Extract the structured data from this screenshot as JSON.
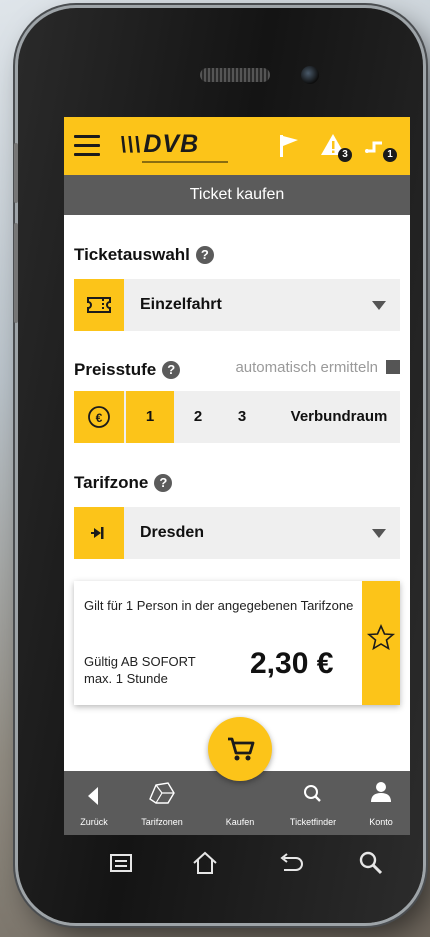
{
  "header": {
    "logo_text": "DVB",
    "logo_stripes": "\\\\\\",
    "notifications": {
      "alerts_count": "3",
      "routes_count": "1"
    }
  },
  "subheader": {
    "title": "Ticket kaufen"
  },
  "ticket_selection": {
    "label": "Ticketauswahl",
    "help": "?",
    "value": "Einzelfahrt"
  },
  "price_level": {
    "label": "Preisstufe",
    "help": "?",
    "auto_label": "automatisch ermitteln",
    "currency_symbol": "€",
    "levels": [
      "1",
      "2",
      "3",
      "Verbundraum"
    ],
    "selected": "1"
  },
  "tariff_zone": {
    "label": "Tarifzone",
    "help": "?",
    "value": "Dresden"
  },
  "ticket_card": {
    "description": "Gilt für 1 Person in der angegebenen Tarifzone",
    "validity_line1": "Gültig AB SOFORT",
    "validity_line2": "max. 1 Stunde",
    "price": "2,30 €"
  },
  "bottom_nav": {
    "back": "Zurück",
    "zones": "Tarifzonen",
    "buy": "Kaufen",
    "finder": "Ticketfinder",
    "account": "Konto"
  },
  "colors": {
    "accent": "#fcc419",
    "bar": "#5b5b5b",
    "field": "#efefef"
  }
}
